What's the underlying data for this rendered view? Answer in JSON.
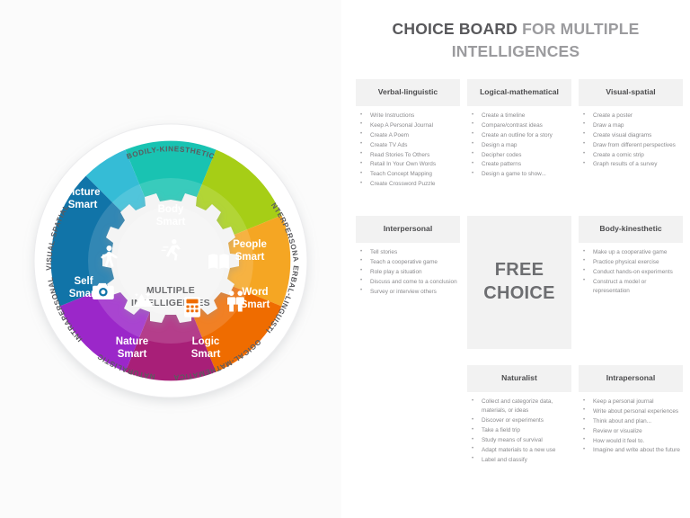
{
  "header": {
    "title_strong": "CHOICE BOARD",
    "title_rest": " FOR MULTIPLE INTELLIGENCES"
  },
  "wheel": {
    "hub_line1": "MULTIPLE",
    "hub_line2": "INTELLIGENCES",
    "segments": [
      {
        "id": "body",
        "line1": "Body",
        "line2": "Smart",
        "color": "#19c3b2",
        "icon": "running-person-icon",
        "ring_label": "BODILY-KINESTHETIC"
      },
      {
        "id": "people",
        "line1": "People",
        "line2": "Smart",
        "color": "#a6ce16",
        "icon": "two-people-icon",
        "ring_label": "INTERPERSONAL"
      },
      {
        "id": "word",
        "line1": "Word",
        "line2": "Smart",
        "color": "#f5a623",
        "icon": "open-book-icon",
        "ring_label": "VERBAL-LINGUISTIC"
      },
      {
        "id": "logic",
        "line1": "Logic",
        "line2": "Smart",
        "color": "#ef6c00",
        "icon": "calculator-icon",
        "ring_label": "LOGICAL-MATHEMATICAL"
      },
      {
        "id": "nature",
        "line1": "Nature",
        "line2": "Smart",
        "color": "#a81f78",
        "icon": "mountain-icon",
        "ring_label": "NATURALISTIC"
      },
      {
        "id": "self",
        "line1": "Self",
        "line2": "Smart",
        "color": "#9b27c9",
        "icon": "person-arms-out-icon",
        "ring_label": "INTRAPERSONAL"
      },
      {
        "id": "picture",
        "line1": "Picture",
        "line2": "Smart",
        "color": "#1174a8",
        "icon": "camera-icon",
        "ring_label": "VISUAL-SPATIAL"
      },
      {
        "id": "body2",
        "line1": "",
        "line2": "",
        "color": "#35bcd6",
        "icon": "",
        "ring_label": ""
      }
    ]
  },
  "cards": [
    {
      "title": "Verbal-linguistic",
      "items": [
        "Write Instructions",
        "Keep A Personal Journal",
        "Create A Poem",
        "Create TV Ads",
        "Read Stories To Others",
        "Retail In Your Own Words",
        "Teach Concept Mapping",
        "Create Crossword Puzzle"
      ]
    },
    {
      "title": "Logical-mathematical",
      "items": [
        "Create a timeline",
        "Compare/contrast ideas",
        "Create an outline for a story",
        "Design a map",
        "Decipher codes",
        "Create patterns",
        "Design a game to show..."
      ]
    },
    {
      "title": "Visual-spatial",
      "items": [
        "Create a poster",
        "Draw a map",
        "Create visual diagrams",
        "Draw from different perspectives",
        "Create a comic strip",
        "Graph results of a survey"
      ]
    },
    {
      "title": "Interpersonal",
      "items": [
        "Tell stories",
        "Teach a cooperative game",
        "Role play a situation",
        "Discuss and come to a conclusion",
        "Survey or interview others"
      ]
    },
    {
      "title": "Body-kinesthetic",
      "items": [
        "Make up a cooperative game",
        "Practice physical exercise",
        "Conduct hands-on experiments",
        "Construct a model or representation"
      ]
    },
    {
      "title": "Naturalist",
      "items": [
        "Collect and categorize data, materials, or ideas",
        "Discover or experiments",
        "Take a field trip",
        "Study means of survival",
        "Adapt materials to a new use",
        "Label and classify"
      ]
    },
    {
      "title": "Intrapersonal",
      "items": [
        "Keep a personal journal",
        "Write about personal experiences",
        "Think about and plan...",
        "Review or visualize",
        "How would it feel to.",
        "Imagine and write about the future"
      ]
    }
  ],
  "free_choice": {
    "line1": "FREE",
    "line2": "CHOICE"
  }
}
